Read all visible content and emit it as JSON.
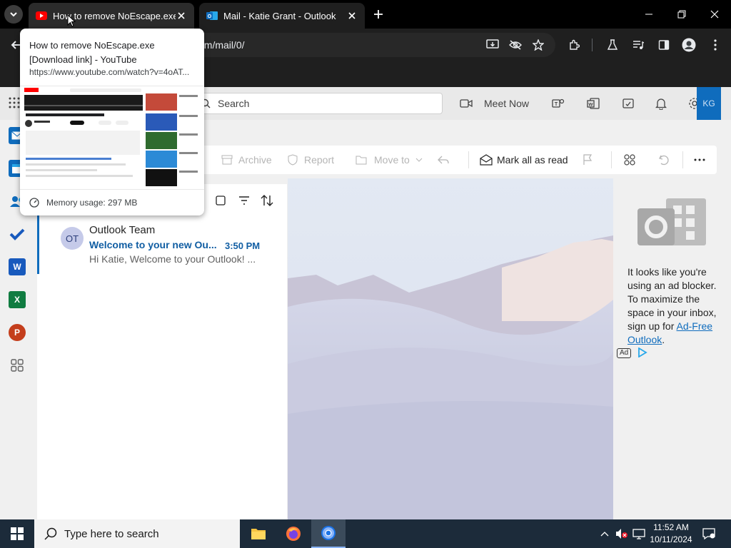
{
  "browser": {
    "tabs": [
      {
        "title": "How to remove NoEscape.exe",
        "favicon": "youtube-icon"
      },
      {
        "title": "Mail - Katie Grant - Outlook",
        "favicon": "outlook-icon"
      }
    ],
    "omnibox_text": "om/mail/0/"
  },
  "hover_card": {
    "title": "How to remove NoEscape.exe [Download link] - YouTube",
    "url": "https://www.youtube.com/watch?v=4oAT...",
    "memory": "Memory usage: 297 MB"
  },
  "outlook": {
    "search_placeholder": "Search",
    "meet_now": "Meet Now",
    "commands": {
      "archive": "Archive",
      "report": "Report",
      "move_to": "Move to",
      "mark_all_read": "Mark all as read"
    },
    "message": {
      "avatar_initials": "OT",
      "sender": "Outlook Team",
      "subject": "Welcome to your new Ou...",
      "time": "3:50 PM",
      "preview": "Hi Katie, Welcome to your Outlook! ..."
    },
    "ad": {
      "text": "It looks like you're using an ad blocker. To maximize the space in your inbox, sign up for ",
      "link": "Ad-Free Outlook",
      "period": ".",
      "badge": "Ad"
    },
    "account_initials": "KG"
  },
  "taskbar": {
    "search_placeholder": "Type here to search",
    "time": "11:52 AM",
    "date": "10/11/2024"
  },
  "colors": {
    "outlook_blue": "#0f6cbd",
    "chrome_dark": "#1f1f1f",
    "taskbar": "#1c2b3a"
  }
}
